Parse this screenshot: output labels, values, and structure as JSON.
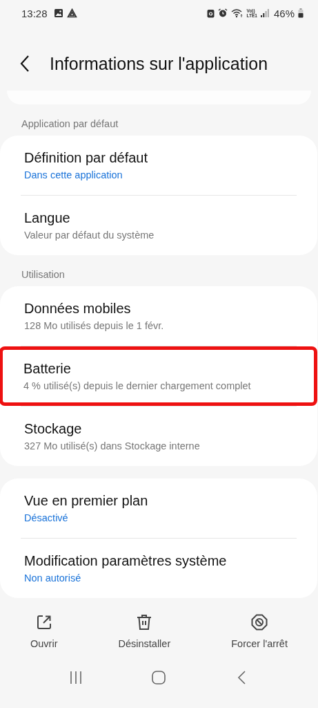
{
  "status_bar": {
    "time": "13:28",
    "volte_top": "Vo))",
    "volte_bottom": "LTE1",
    "battery": "46%"
  },
  "header": {
    "title": "Informations sur l'application"
  },
  "sections": [
    {
      "label": "Application par défaut",
      "items": [
        {
          "title": "Définition par défaut",
          "subtitle": "Dans cette application",
          "accent": true,
          "highlighted": false
        },
        {
          "title": "Langue",
          "subtitle": "Valeur par défaut du système",
          "accent": false,
          "highlighted": false
        }
      ]
    },
    {
      "label": "Utilisation",
      "items": [
        {
          "title": "Données mobiles",
          "subtitle": "128 Mo utilisés depuis le 1 févr.",
          "accent": false,
          "highlighted": false
        },
        {
          "title": "Batterie",
          "subtitle": "4 % utilisé(s) depuis le dernier chargement complet",
          "accent": false,
          "highlighted": true
        },
        {
          "title": "Stockage",
          "subtitle": "327 Mo utilisé(s) dans Stockage interne",
          "accent": false,
          "highlighted": false
        }
      ]
    },
    {
      "items": [
        {
          "title": "Vue en premier plan",
          "subtitle": "Désactivé",
          "accent": true,
          "highlighted": false
        },
        {
          "title": "Modification paramètres système",
          "subtitle": "Non autorisé",
          "accent": true,
          "highlighted": false
        }
      ]
    }
  ],
  "actions": [
    {
      "kind": "open",
      "label": "Ouvrir"
    },
    {
      "kind": "uninstall",
      "label": "Désinstaller"
    },
    {
      "kind": "stop",
      "label": "Forcer l'arrêt"
    }
  ]
}
